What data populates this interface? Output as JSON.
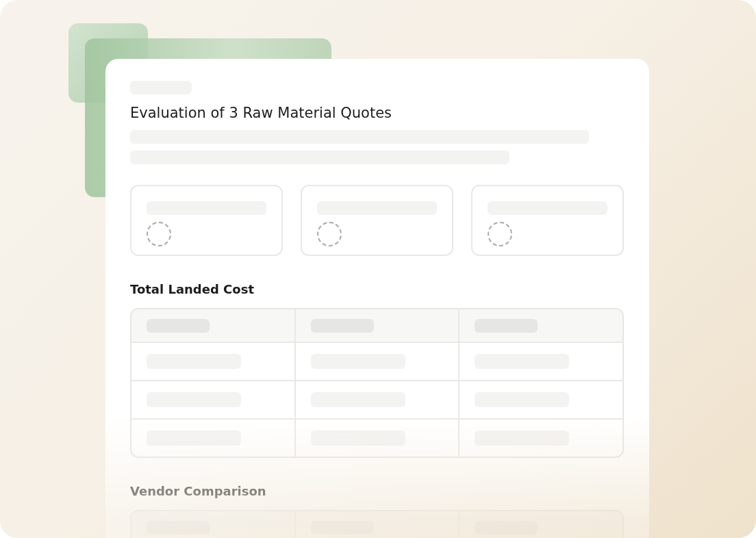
{
  "document": {
    "title": "Evaluation of 3 Raw Material Quotes",
    "loading": true
  },
  "summary_cards": [
    {
      "loading": true
    },
    {
      "loading": true
    },
    {
      "loading": true
    }
  ],
  "sections": [
    {
      "heading": "Total Landed Cost",
      "table": {
        "columns": [
          {
            "loading": true
          },
          {
            "loading": true
          },
          {
            "loading": true
          }
        ],
        "rows": [
          {
            "loading": true
          },
          {
            "loading": true
          },
          {
            "loading": true
          }
        ]
      }
    },
    {
      "heading": "Vendor Comparison",
      "table": {
        "columns": [
          {
            "loading": true
          },
          {
            "loading": true
          },
          {
            "loading": true
          }
        ]
      }
    }
  ]
}
